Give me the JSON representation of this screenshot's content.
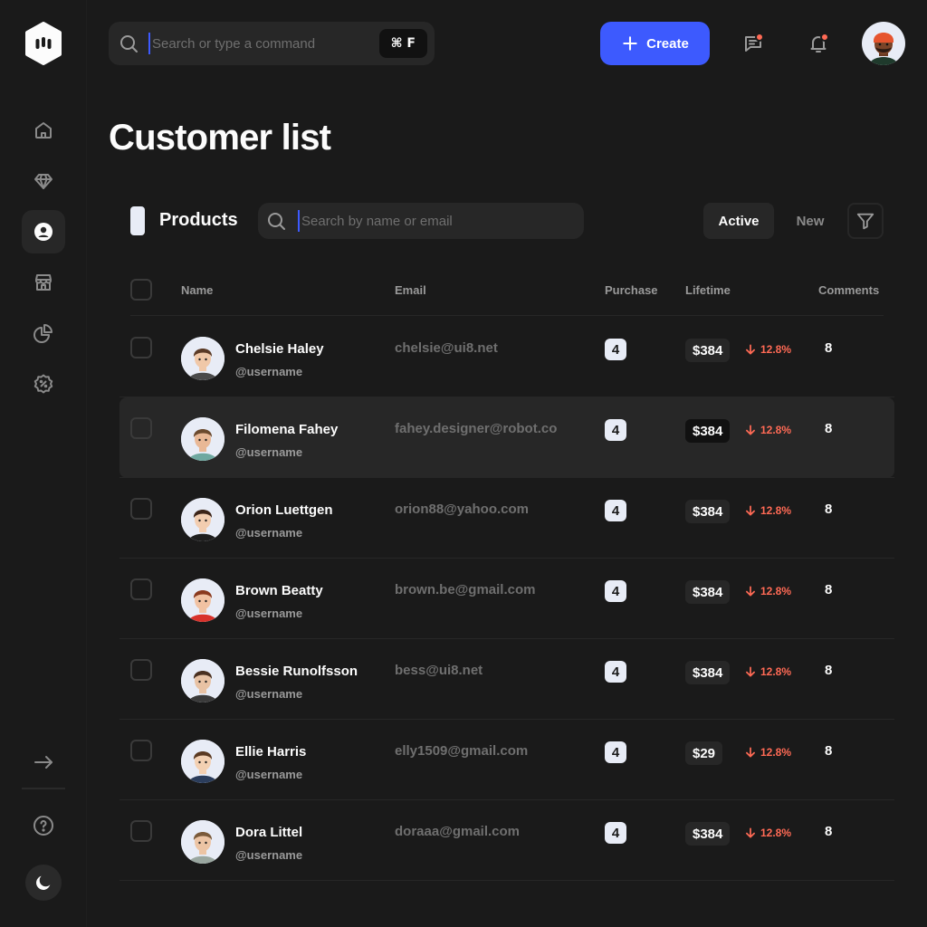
{
  "header": {
    "search_placeholder": "Search or type a command",
    "shortcut": "⌘ F",
    "create_label": "Create"
  },
  "page": {
    "title": "Customer list"
  },
  "toolbar": {
    "section_title": "Products",
    "search_placeholder": "Search by name or email",
    "tabs": [
      "Active",
      "New"
    ]
  },
  "table": {
    "columns": [
      "Name",
      "Email",
      "Purchase",
      "Lifetime",
      "Comments"
    ],
    "rows": [
      {
        "name": "Chelsie Haley",
        "username": "@username",
        "email": "chelsie@ui8.net",
        "purchase": "4",
        "lifetime": "$384",
        "trend": "12.8%",
        "comments": "8"
      },
      {
        "name": "Filomena Fahey",
        "username": "@username",
        "email": "fahey.designer@robot.co",
        "purchase": "4",
        "lifetime": "$384",
        "trend": "12.8%",
        "comments": "8"
      },
      {
        "name": "Orion Luettgen",
        "username": "@username",
        "email": "orion88@yahoo.com",
        "purchase": "4",
        "lifetime": "$384",
        "trend": "12.8%",
        "comments": "8"
      },
      {
        "name": "Brown Beatty",
        "username": "@username",
        "email": "brown.be@gmail.com",
        "purchase": "4",
        "lifetime": "$384",
        "trend": "12.8%",
        "comments": "8"
      },
      {
        "name": "Bessie Runolfsson",
        "username": "@username",
        "email": "bess@ui8.net",
        "purchase": "4",
        "lifetime": "$384",
        "trend": "12.8%",
        "comments": "8"
      },
      {
        "name": "Ellie Harris",
        "username": "@username",
        "email": "elly1509@gmail.com",
        "purchase": "4",
        "lifetime": "$29",
        "trend": "12.8%",
        "comments": "8"
      },
      {
        "name": "Dora Littel",
        "username": "@username",
        "email": "doraaa@gmail.com",
        "purchase": "4",
        "lifetime": "$384",
        "trend": "12.8%",
        "comments": "8"
      }
    ]
  },
  "colors": {
    "background": "#1a1a1a",
    "surface": "#272727",
    "accent": "#3d5afe",
    "negative": "#ff6a55",
    "text": "#fcfcfc",
    "muted": "#6f6f6f"
  },
  "icons": {
    "sidebar": [
      "home-icon",
      "diamond-icon",
      "user-circle-icon",
      "store-icon",
      "pie-chart-icon",
      "discount-icon"
    ],
    "sidebar_bottom": [
      "arrow-right-icon",
      "help-icon",
      "moon-icon"
    ],
    "header": [
      "search-icon",
      "plus-icon",
      "message-icon",
      "bell-icon"
    ]
  }
}
